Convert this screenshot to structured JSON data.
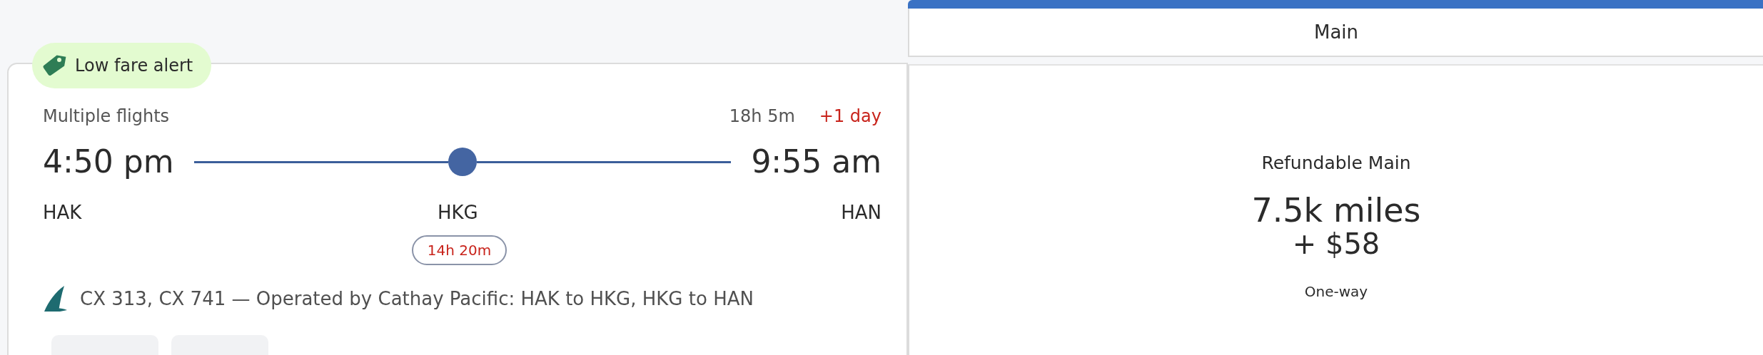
{
  "badge": {
    "label": "Low fare alert"
  },
  "flight": {
    "summary": "Multiple flights",
    "duration": "18h 5m",
    "day_offset": "+1 day",
    "depart_time": "4:50 pm",
    "arrive_time": "9:55 am",
    "origin": "HAK",
    "stop": "HKG",
    "destination": "HAN",
    "layover": "14h 20m",
    "details": "CX 313, CX 741 — Operated by Cathay Pacific: HAK to HKG, HKG to HAN"
  },
  "fare_column": {
    "header": "Main",
    "fare_name": "Refundable Main",
    "miles": "7.5k miles",
    "cash": "+ $58",
    "trip_type": "One-way"
  }
}
